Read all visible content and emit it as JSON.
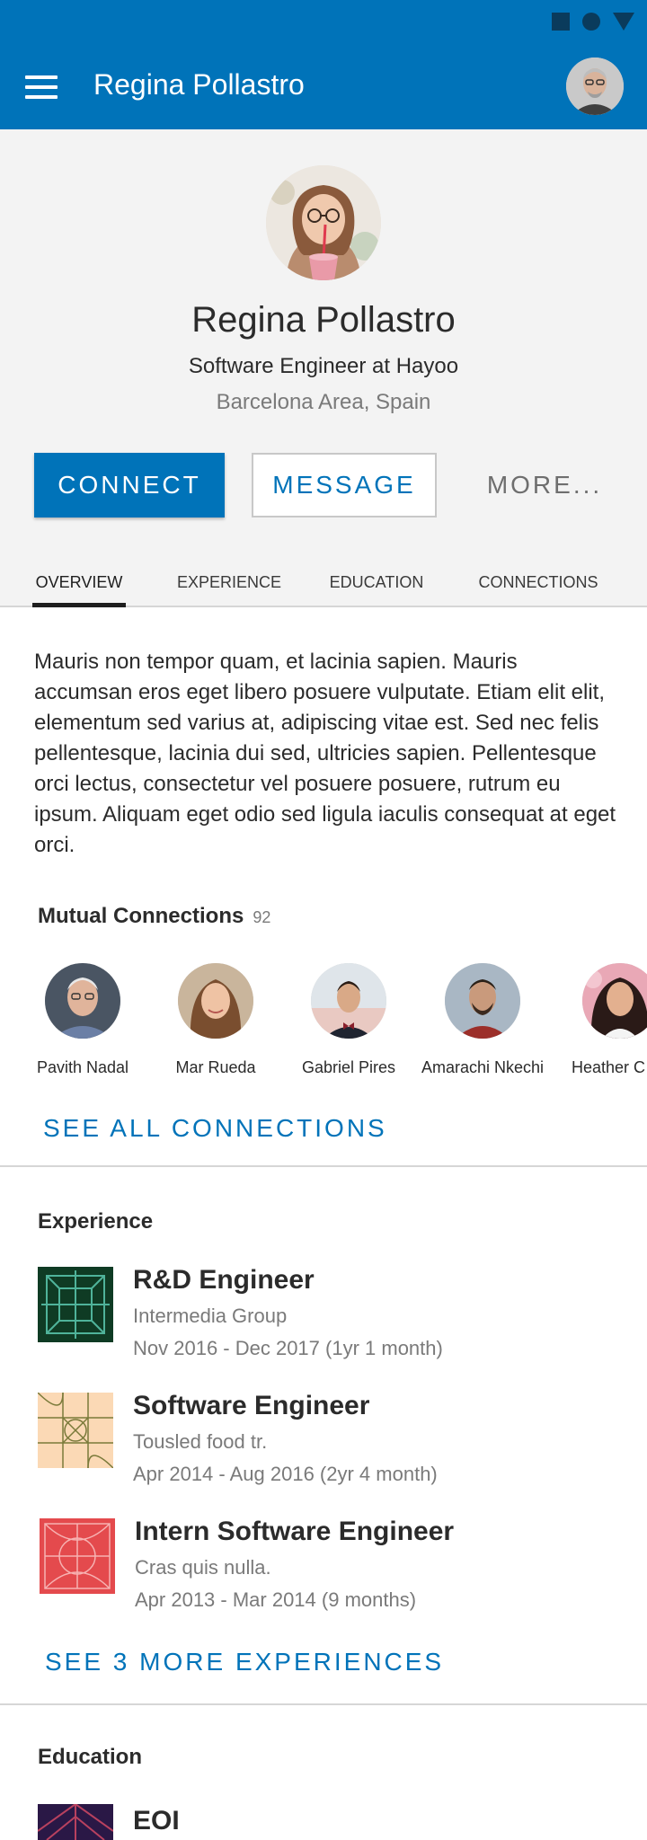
{
  "app_bar": {
    "title": "Regina Pollastro",
    "menu_icon": "hamburger-menu-icon",
    "avatar_icon": "user-avatar"
  },
  "status_bar": {
    "icons": [
      "square-icon",
      "circle-icon",
      "triangle-icon"
    ]
  },
  "profile": {
    "name": "Regina Pollastro",
    "headline": "Software Engineer at Hayoo",
    "location": "Barcelona Area, Spain",
    "buttons": {
      "connect": "CONNECT",
      "message": "MESSAGE",
      "more": "MORE..."
    }
  },
  "tabs": [
    {
      "label": "OVERVIEW",
      "active": true
    },
    {
      "label": "EXPERIENCE",
      "active": false
    },
    {
      "label": "EDUCATION",
      "active": false
    },
    {
      "label": "CONNECTIONS",
      "active": false
    }
  ],
  "about": "Mauris non tempor quam, et lacinia sapien. Mauris accumsan eros eget libero posuere vulputate. Etiam elit elit, elementum sed varius at, adipiscing vitae est. Sed nec felis pellentesque, lacinia dui sed, ultricies sapien. Pellentesque orci lectus, consectetur vel posuere posuere, rutrum eu ipsum. Aliquam eget odio sed ligula iaculis consequat at eget orci.",
  "mutual": {
    "title": "Mutual Connections",
    "count": "92",
    "people": [
      {
        "name": "Pavith Nadal"
      },
      {
        "name": "Mar Rueda"
      },
      {
        "name": "Gabriel Pires"
      },
      {
        "name": "Amarachi Nkechi"
      },
      {
        "name": "Heather C"
      }
    ],
    "see_all": "SEE ALL CONNECTIONS"
  },
  "experience": {
    "title": "Experience",
    "items": [
      {
        "title": "R&D Engineer",
        "company": "Intermedia Group",
        "dates": "Nov 2016 - Dec 2017 (1yr 1 month)"
      },
      {
        "title": "Software Engineer",
        "company": "Tousled food tr.",
        "dates": "Apr 2014 - Aug 2016 (2yr 4 month)"
      },
      {
        "title": "Intern Software Engineer",
        "company": "Cras quis nulla.",
        "dates": "Apr 2013 - Mar 2014 (9 months)"
      }
    ],
    "see_more": "SEE 3 MORE EXPERIENCES"
  },
  "education": {
    "title": "Education",
    "items": [
      {
        "title": "EOI"
      }
    ]
  },
  "colors": {
    "brand": "#0073b9",
    "background": "#f3f3f3",
    "muted_text": "#7a7a7a"
  }
}
